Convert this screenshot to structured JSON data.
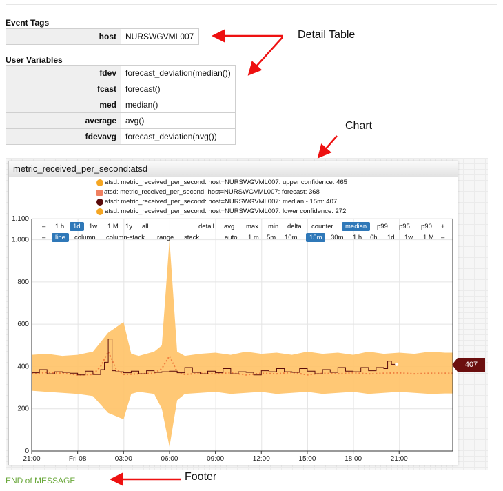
{
  "event_tags": {
    "title": "Event Tags",
    "rows": [
      {
        "key": "host",
        "value": "NURSWGVML007"
      }
    ]
  },
  "user_variables": {
    "title": "User Variables",
    "rows": [
      {
        "key": "fdev",
        "value": "forecast_deviation(median())"
      },
      {
        "key": "fcast",
        "value": "forecast()"
      },
      {
        "key": "med",
        "value": "median()"
      },
      {
        "key": "average",
        "value": "avg()"
      },
      {
        "key": "fdevavg",
        "value": "forecast_deviation(avg())"
      }
    ]
  },
  "annotations": {
    "detail_table": "Detail Table",
    "chart": "Chart",
    "footer": "Footer"
  },
  "colors": {
    "annotation_arrow": "#ee1111",
    "band": "#ffc266",
    "forecast": "#f08040",
    "median": "#5a0b0b",
    "selected": "#2f78b8",
    "footer": "#6aa83b"
  },
  "widget": {
    "title": "metric_received_per_second:atsd",
    "legend": [
      {
        "label": "atsd: metric_received_per_second: host=NURSWGVML007: upper confidence: 465",
        "color": "#f5a623",
        "shape": "circle"
      },
      {
        "label": "atsd: metric_received_per_second: host=NURSWGVML007: forecast: 368",
        "color": "#f08060",
        "shape": "square"
      },
      {
        "label": "atsd: metric_received_per_second: host=NURSWGVML007: median - 15m: 407",
        "color": "#5a0b0b",
        "shape": "circle"
      },
      {
        "label": "atsd: metric_received_per_second: host=NURSWGVML007: lower confidence: 272",
        "color": "#f5a623",
        "shape": "circle"
      }
    ],
    "menu_row1": {
      "left": [
        "–",
        "1 h",
        "1d",
        "1w",
        "1 M",
        "1y",
        "all"
      ],
      "left_selected": "1d",
      "right": [
        "detail",
        "avg",
        "max",
        "min",
        "delta",
        "counter",
        "median",
        "p99",
        "p95",
        "p90",
        "+"
      ],
      "right_selected": "median"
    },
    "menu_row2": {
      "left": [
        "–",
        "line",
        "column",
        "column-stack",
        "range",
        "stack"
      ],
      "left_selected": "line",
      "right": [
        "auto",
        "1 m",
        "5m",
        "10m",
        "15m",
        "30m",
        "1 h",
        "6h",
        "1d",
        "1w",
        "1 M",
        "–"
      ],
      "right_selected": "15m"
    },
    "last_value": "407"
  },
  "chart_data": {
    "type": "line",
    "x_ticks": [
      "21:00",
      "Fri 08",
      "03:00",
      "06:00",
      "09:00",
      "12:00",
      "15:00",
      "18:00",
      "21:00"
    ],
    "y_ticks": [
      "0",
      "200",
      "400",
      "600",
      "800",
      "1.000",
      "1.100"
    ],
    "ylim": [
      0,
      1100
    ],
    "x_hours": [
      -3,
      24.5
    ],
    "series": [
      {
        "name": "upper confidence",
        "x": [
          -3,
          -2,
          -1,
          0,
          1,
          2,
          3,
          3.5,
          4,
          5,
          5.5,
          6,
          6.5,
          7,
          8,
          9,
          10,
          11,
          12,
          13,
          14,
          15,
          16,
          17,
          18,
          19,
          20,
          21,
          22,
          23,
          24,
          24.5
        ],
        "values": [
          455,
          460,
          450,
          455,
          470,
          560,
          610,
          460,
          450,
          470,
          500,
          1000,
          470,
          450,
          460,
          465,
          455,
          470,
          460,
          465,
          455,
          470,
          460,
          465,
          455,
          470,
          460,
          465,
          460,
          470,
          465,
          465
        ]
      },
      {
        "name": "lower confidence",
        "x": [
          -3,
          -2,
          -1,
          0,
          1,
          2,
          3,
          3.5,
          4,
          5,
          5.5,
          6,
          6.5,
          7,
          8,
          9,
          10,
          11,
          12,
          13,
          14,
          15,
          16,
          17,
          18,
          19,
          20,
          21,
          22,
          23,
          24,
          24.5
        ],
        "values": [
          285,
          280,
          275,
          270,
          260,
          180,
          150,
          270,
          280,
          270,
          200,
          20,
          240,
          270,
          275,
          280,
          270,
          275,
          280,
          270,
          275,
          280,
          270,
          275,
          280,
          270,
          275,
          280,
          275,
          270,
          272,
          272
        ]
      },
      {
        "name": "forecast",
        "x": [
          -3,
          -2,
          -1,
          0,
          1,
          1.5,
          2,
          2.5,
          3,
          4,
          5,
          5.5,
          6,
          6.5,
          7,
          8,
          9,
          10,
          11,
          12,
          13,
          14,
          15,
          16,
          17,
          18,
          19,
          20,
          21,
          22,
          23,
          24,
          24.5
        ],
        "values": [
          365,
          372,
          368,
          360,
          362,
          400,
          470,
          390,
          362,
          365,
          368,
          390,
          450,
          375,
          362,
          368,
          365,
          370,
          360,
          368,
          365,
          372,
          360,
          368,
          365,
          370,
          365,
          368,
          370,
          365,
          368,
          368,
          368
        ]
      },
      {
        "name": "median - 15m",
        "x": [
          -3,
          -2.5,
          -2,
          -1.5,
          -1,
          -0.5,
          0,
          0.5,
          1,
          1.5,
          1.75,
          2,
          2.25,
          2.5,
          3,
          3.5,
          4,
          4.5,
          5,
          5.5,
          6,
          6.5,
          7,
          7.5,
          8,
          8.5,
          9,
          9.5,
          10,
          10.5,
          11,
          11.5,
          12,
          12.5,
          13,
          13.5,
          14,
          14.5,
          15,
          15.5,
          16,
          16.5,
          17,
          17.5,
          18,
          18.5,
          19,
          19.5,
          20,
          20.25,
          20.5
        ],
        "values": [
          370,
          385,
          365,
          375,
          372,
          368,
          360,
          378,
          362,
          385,
          420,
          530,
          380,
          375,
          370,
          378,
          365,
          380,
          372,
          375,
          378,
          370,
          395,
          372,
          365,
          378,
          370,
          390,
          365,
          375,
          372,
          360,
          380,
          375,
          390,
          375,
          372,
          390,
          378,
          365,
          385,
          372,
          395,
          378,
          375,
          395,
          380,
          395,
          390,
          425,
          410
        ]
      }
    ]
  },
  "footer": {
    "text": "END of MESSAGE"
  }
}
